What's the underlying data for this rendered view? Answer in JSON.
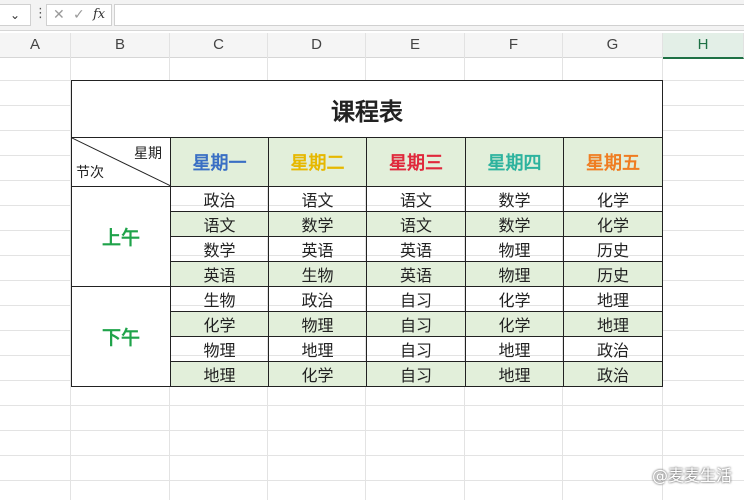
{
  "formula_bar": {
    "fx_label": "fx",
    "formula": ""
  },
  "columns": [
    "A",
    "B",
    "C",
    "D",
    "E",
    "F",
    "G",
    "H"
  ],
  "table": {
    "title": "课程表",
    "corner_top": "星期",
    "corner_bottom": "节次",
    "days": [
      {
        "label": "星期一",
        "color": "#3a6fc4"
      },
      {
        "label": "星期二",
        "color": "#e6b800"
      },
      {
        "label": "星期三",
        "color": "#e0283c"
      },
      {
        "label": "星期四",
        "color": "#2db39e"
      },
      {
        "label": "星期五",
        "color": "#ef7d22"
      }
    ],
    "morning_label": "上午",
    "afternoon_label": "下午",
    "rows": [
      [
        "政治",
        "语文",
        "语文",
        "数学",
        "化学"
      ],
      [
        "语文",
        "数学",
        "语文",
        "数学",
        "化学"
      ],
      [
        "数学",
        "英语",
        "英语",
        "物理",
        "历史"
      ],
      [
        "英语",
        "生物",
        "英语",
        "物理",
        "历史"
      ],
      [
        "生物",
        "政治",
        "自习",
        "化学",
        "地理"
      ],
      [
        "化学",
        "物理",
        "自习",
        "化学",
        "地理"
      ],
      [
        "物理",
        "地理",
        "自习",
        "地理",
        "政治"
      ],
      [
        "地理",
        "化学",
        "自习",
        "地理",
        "政治"
      ]
    ]
  },
  "watermark": "@麦麦生活"
}
